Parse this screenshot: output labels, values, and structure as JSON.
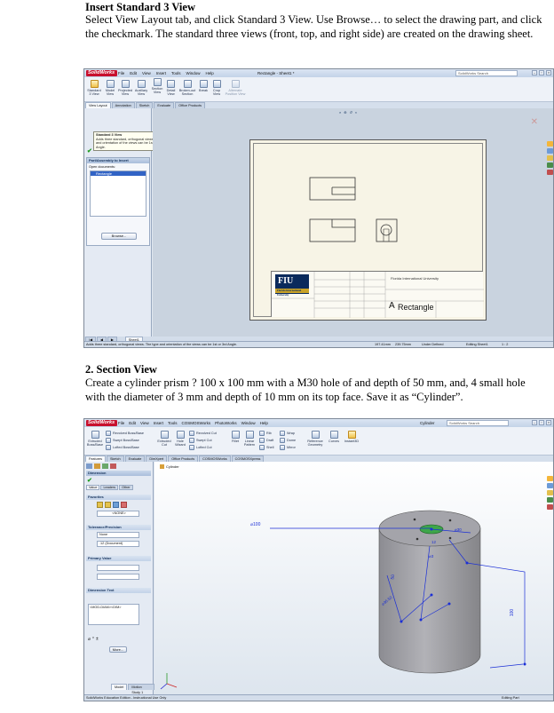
{
  "section1": {
    "heading": "Insert Standard 3 View",
    "body": "Select View Layout tab, and click Standard 3 View. Use Browse… to select the drawing part, and click the checkmark. The standard three views (front, top, and right side) are created on the drawing sheet."
  },
  "section2": {
    "heading": "2. Section View",
    "body": "Create a cylinder prism ? 100 x 100 mm with a M30 hole of and depth of 50 mm, and, 4 small hole with the diameter of 3 mm and depth of 10 mm on its top face. Save it as “Cylinder”."
  },
  "app": {
    "name": "SolidWorks"
  },
  "shot1": {
    "menus": [
      "File",
      "Edit",
      "View",
      "Insert",
      "Tools",
      "Window",
      "Help"
    ],
    "doc_title": "Rectangle - Sheet1 *",
    "search_placeholder": "SolidWorks Search",
    "tools": [
      "Standard 3 View",
      "Model View",
      "Projected View",
      "Auxiliary View",
      "Section View",
      "Detail View",
      "Broken-out Section",
      "Break",
      "Crop View",
      "Alternate Position View"
    ],
    "tabs": [
      "View Layout",
      "Annotation",
      "Sketch",
      "Evaluate",
      "Office Products"
    ],
    "tooltip_title": "Standard 3 View",
    "tooltip_body": "Adds three standard, orthogonal views. The type and orientation of the views can be 1st or 3rd Angle.",
    "panel_title": "Part/Assembly to Insert",
    "open_docs_label": "Open documents:",
    "open_doc_item": "Rectangle",
    "browse_label": "Browse...",
    "title_block": {
      "university": "Florida International University",
      "logo_text": "FIU",
      "logo_sub": "Florida International University",
      "part_name": "Rectangle",
      "size": "A"
    },
    "sheet_tab": "Sheet1",
    "status_text": "Adds three standard, orthogonal views. The type and orientation of the views can be 1st or 3rd Angle.",
    "status_x": "197.41mm",
    "status_y": "239.75mm",
    "status_state": "Under Defined",
    "status_edit": "Editing Sheet1",
    "status_scale": "1 : 2"
  },
  "shot2": {
    "menus": [
      "File",
      "Edit",
      "View",
      "Insert",
      "Tools",
      "COSMOSWorks",
      "PhotoWorks",
      "Window",
      "Help"
    ],
    "doc_title": "Cylinder",
    "search_placeholder": "SolidWorks Search",
    "tools_large": [
      "Extruded Boss/Base",
      "Revolved Boss/Base",
      "Extruded Cut",
      "Hole Wizard",
      "Fillet",
      "Linear Pattern",
      "Reference Geometry",
      "Curves",
      "Instant3D"
    ],
    "tools_small": [
      "Revolved Boss/Base",
      "Swept Boss/Base",
      "Lofted Boss/Base",
      "Revolved Cut",
      "Swept Cut",
      "Lofted Cut",
      "Rib",
      "Draft",
      "Shell",
      "Wrap",
      "Dome",
      "Mirror"
    ],
    "tabs": [
      "Features",
      "Sketch",
      "Evaluate",
      "DimXpert",
      "Office Products",
      "COSMOSWorks",
      "COSMOSXpress"
    ],
    "panel_title": "Dimension",
    "panel_tabs": [
      "Value",
      "Leaders",
      "Other"
    ],
    "favorites_label": "Favorites",
    "favorites_value": "<NONE>",
    "tolerance_label": "Tolerance/Precision",
    "tol_none": "None",
    "tol_doc": ".12 (Document)",
    "primary_label": "Primary Value",
    "dim_text_label": "Dimension Text",
    "dim_text_value": "<MOD-DIAM><DIM>",
    "more_label": "More...",
    "tree_item": "Cylinder",
    "bottom_tabs": [
      "Model",
      "Motion Study 1"
    ],
    "dims": [
      "⌀100",
      "100",
      "50",
      "⌀30",
      "12",
      "⌀3",
      "⌀36.50"
    ],
    "status_left": "SolidWorks Education Edition - Instructional Use Only",
    "status_edit": "Editing Part"
  },
  "colors": {
    "accent": "#c8102e",
    "dim_blue": "#1b2fd6",
    "cylinder_gray": "#9a9a9f"
  }
}
